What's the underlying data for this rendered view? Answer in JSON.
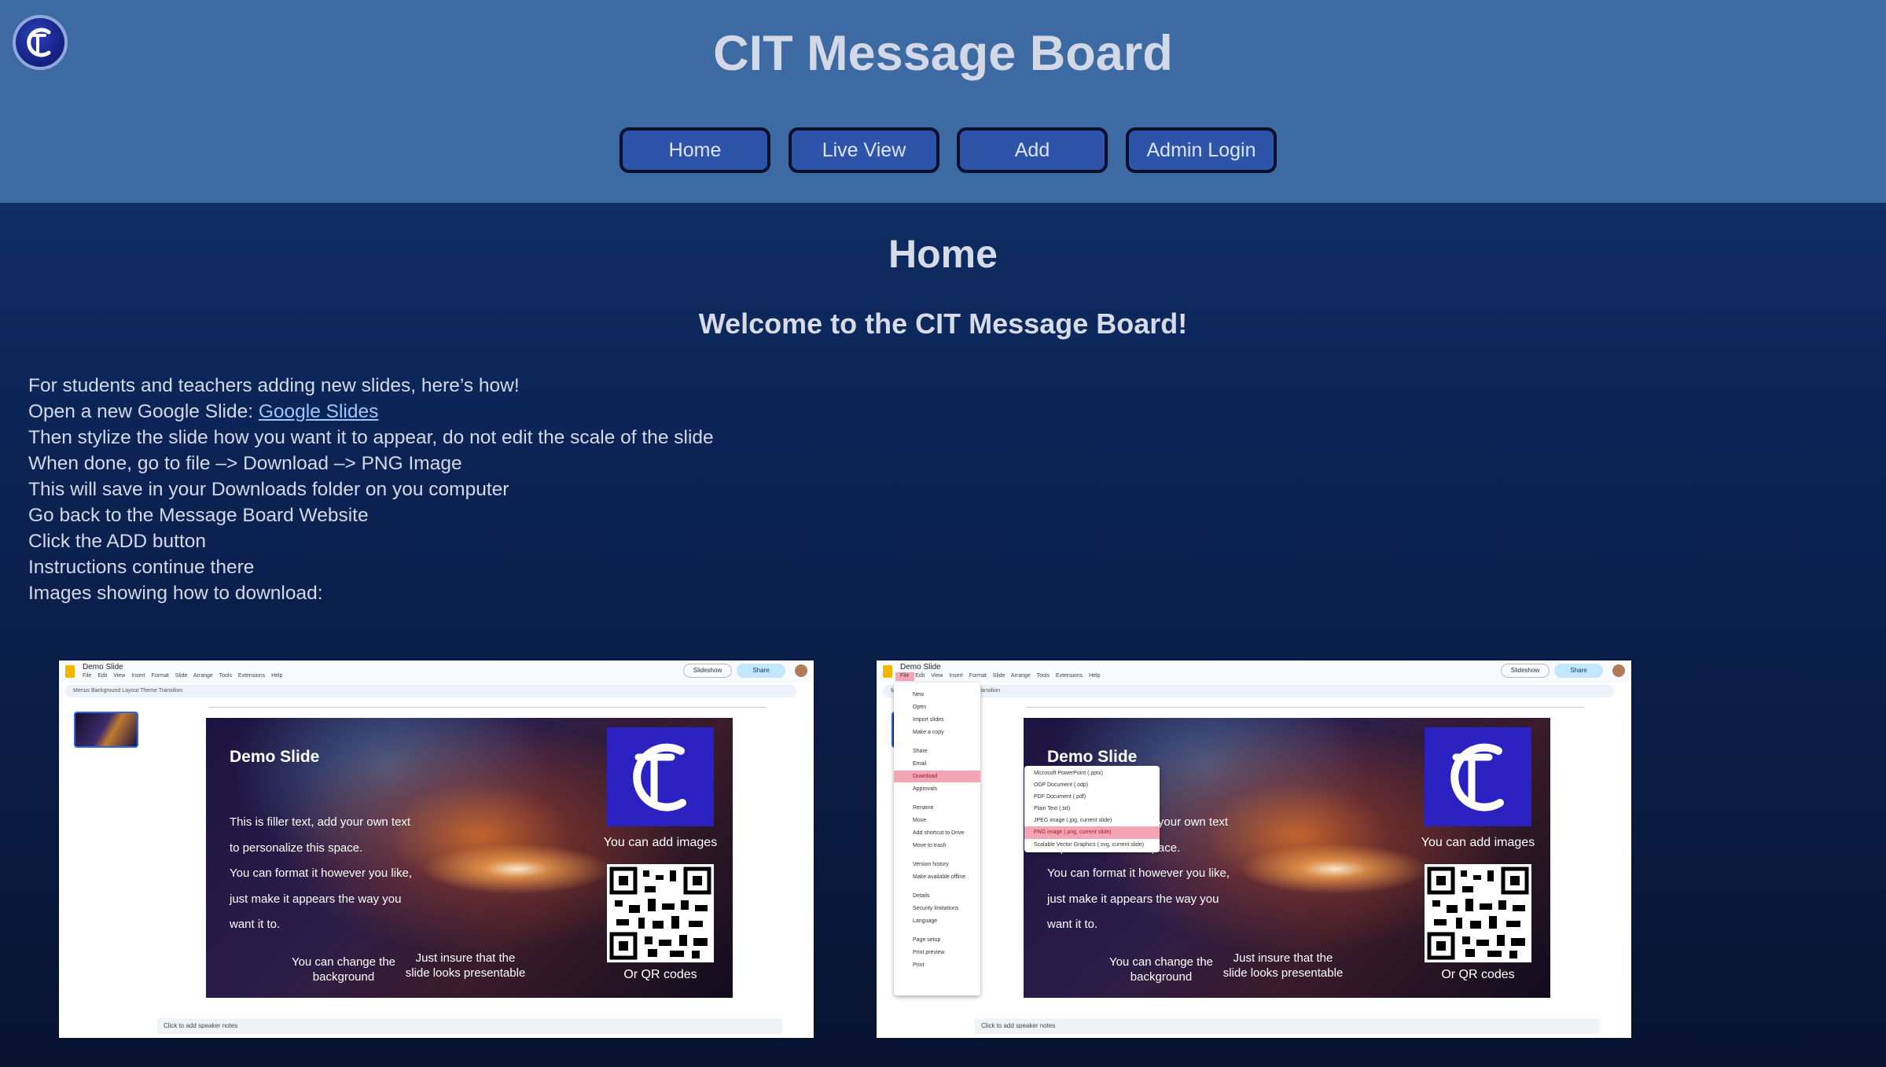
{
  "site": {
    "title": "CIT Message Board"
  },
  "nav": {
    "items": [
      "Home",
      "Live View",
      "Add",
      "Admin Login"
    ]
  },
  "page": {
    "title": "Home",
    "welcome": "Welcome to the CIT Message Board!"
  },
  "instructions": {
    "line1": "For students and teachers adding new slides, here’s how!",
    "line2_prefix": "Open a new Google Slide: ",
    "line2_link": "Google Slides",
    "line3": "Then stylize the slide how you want it to appear, do not edit the scale of the slide",
    "line4": "When done, go to file –> Download –> PNG Image",
    "line5": "This will save in your Downloads folder on you computer",
    "line6": "Go back to the Message Board Website",
    "line7": "Click the ADD button",
    "line8": "Instructions continue there",
    "line9": "Images showing how to download:"
  },
  "screenshot": {
    "doc_title": "Demo Slide",
    "menus": "File Edit View Insert Format Slide Arrange Tools Extensions Help",
    "toolbar": "Menus  Background  Layout  Theme  Transition",
    "slideshow": "Slideshow",
    "share": "Share",
    "notes": "Click to add speaker notes",
    "slide": {
      "title": "Demo Slide",
      "body1": "This is filler text, add your own text",
      "body2": "to personalize this space.",
      "body3": "You can format it however you like,",
      "body4": "just make it appears the way you",
      "body5": "want it to.",
      "caption_bg": "You can change the background",
      "caption_present": "Just insure that the slide looks presentable",
      "caption_images": "You can add images",
      "caption_qr": "Or QR codes"
    },
    "file_menu": [
      "New",
      "Open",
      "Import slides",
      "Make a copy",
      "Share",
      "Email",
      "Download",
      "Approvals",
      "Rename",
      "Move",
      "Add shortcut to Drive",
      "Move to trash",
      "Version history",
      "Make available offline",
      "Details",
      "Security limitations",
      "Language",
      "Page setup",
      "Print preview",
      "Print"
    ],
    "download_menu": [
      "Microsoft PowerPoint (.pptx)",
      "ODP Document (.odp)",
      "PDF Document (.pdf)",
      "Plain Text (.txt)",
      "JPEG image (.jpg, current slide)",
      "PNG image (.png, current slide)",
      "Scalable Vector Graphics (.svg, current slide)"
    ]
  },
  "colors": {
    "header_bg": "#3d6aa3",
    "button_bg": "#2d54a8",
    "link": "#9ec6ff"
  }
}
